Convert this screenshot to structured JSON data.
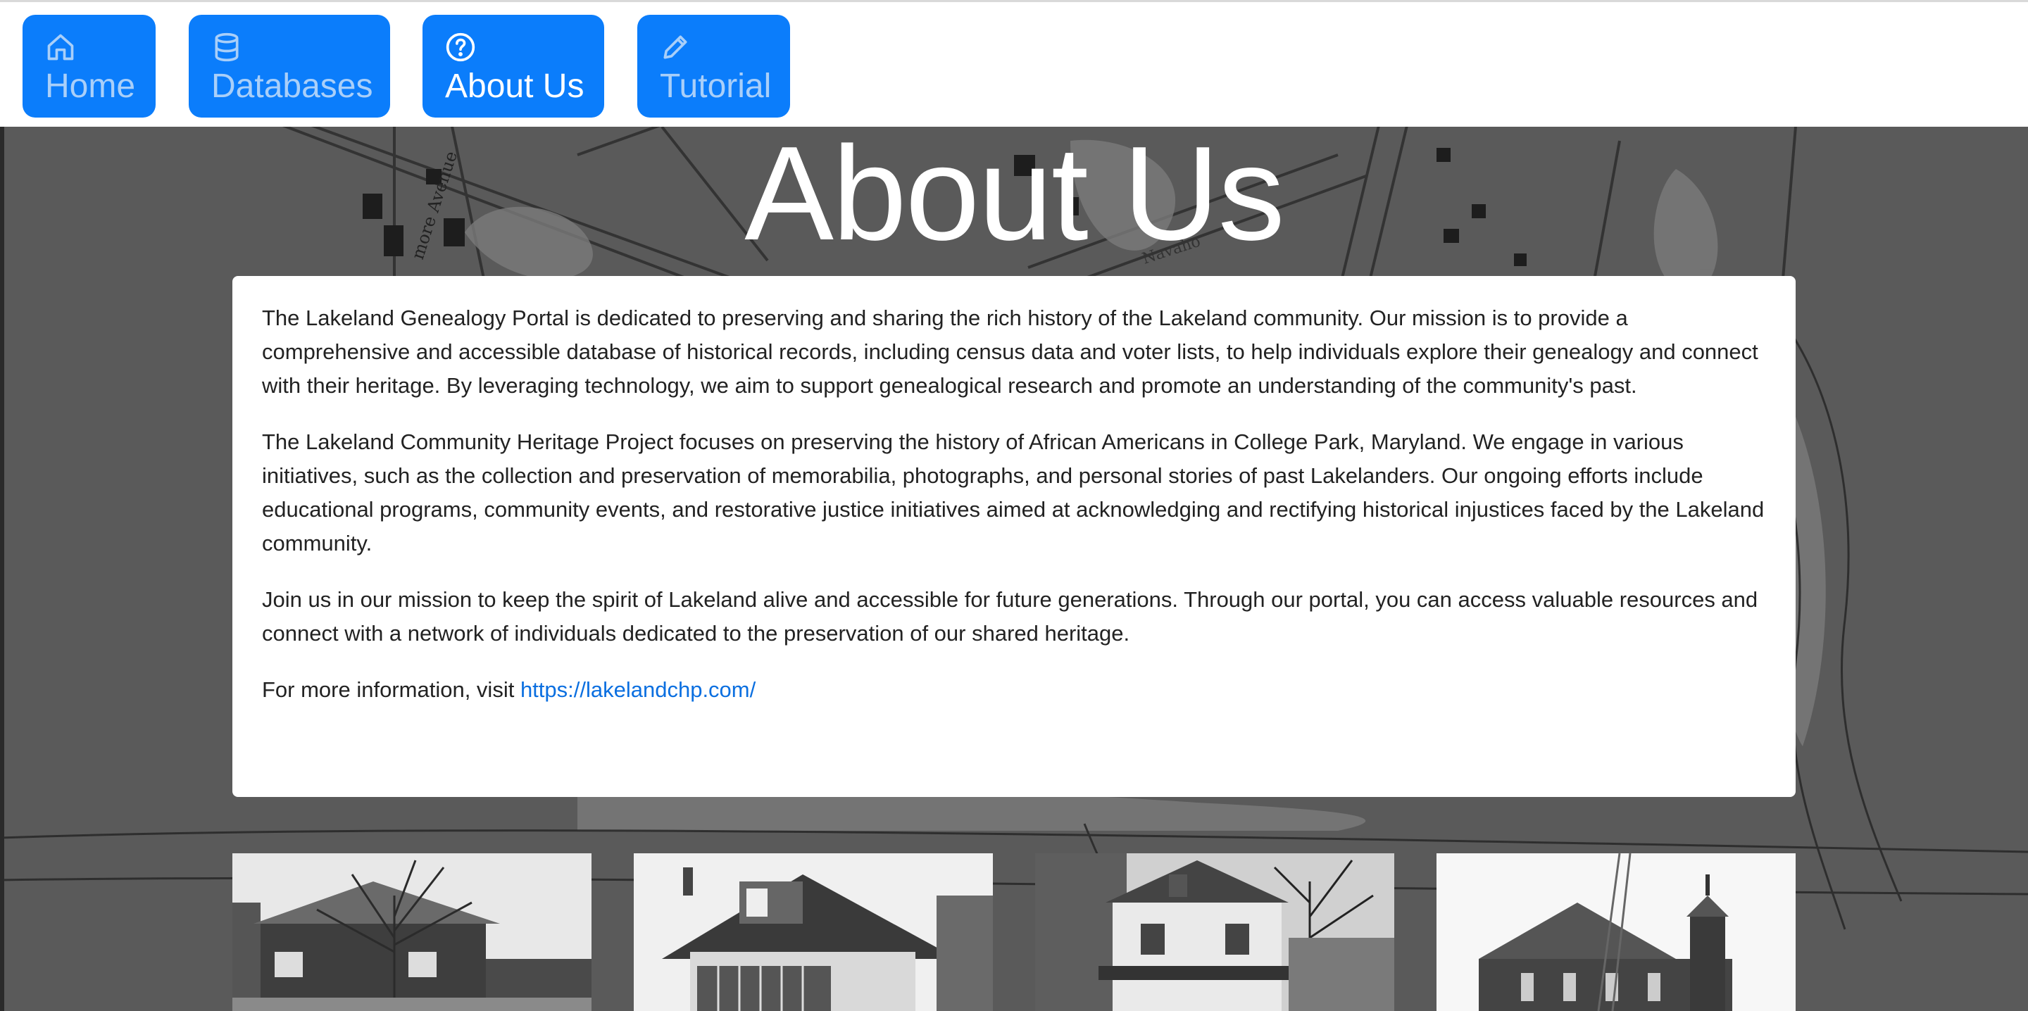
{
  "nav": {
    "items": [
      {
        "label": "Home",
        "icon": "home-icon",
        "active": false
      },
      {
        "label": "Databases",
        "icon": "database-icon",
        "active": false
      },
      {
        "label": "About Us",
        "icon": "question-circle-icon",
        "active": true
      },
      {
        "label": "Tutorial",
        "icon": "pencil-icon",
        "active": false
      }
    ]
  },
  "page": {
    "title": "About Us"
  },
  "about": {
    "paragraph_1": "The Lakeland Genealogy Portal is dedicated to preserving and sharing the rich history of the Lakeland community. Our mission is to provide a comprehensive and accessible database of historical records, including census data and voter lists, to help individuals explore their genealogy and connect with their heritage. By leveraging technology, we aim to support genealogical research and promote an understanding of the community's past.",
    "paragraph_2": "The Lakeland Community Heritage Project focuses on preserving the history of African Americans in College Park, Maryland. We engage in various initiatives, such as the collection and preservation of memorabilia, photographs, and personal stories of past Lakelanders. Our ongoing efforts include educational programs, community events, and restorative justice initiatives aimed at acknowledging and rectifying historical injustices faced by the Lakeland community.",
    "paragraph_3": "Join us in our mission to keep the spirit of Lakeland alive and accessible for future generations. Through our portal, you can access valuable resources and connect with a network of individuals dedicated to the preservation of our shared heritage.",
    "more_info_prefix": "For more information, visit ",
    "link_text": "https://lakelandchp.com/"
  },
  "background_map": {
    "street_labels": [
      "more Avenue",
      "Navaho"
    ]
  },
  "colors": {
    "nav_button": "#0b7dfb",
    "nav_inactive_text": "#a9cff9",
    "nav_active_text": "#ffffff",
    "link": "#0b6fe0",
    "hero_background": "#595959"
  }
}
